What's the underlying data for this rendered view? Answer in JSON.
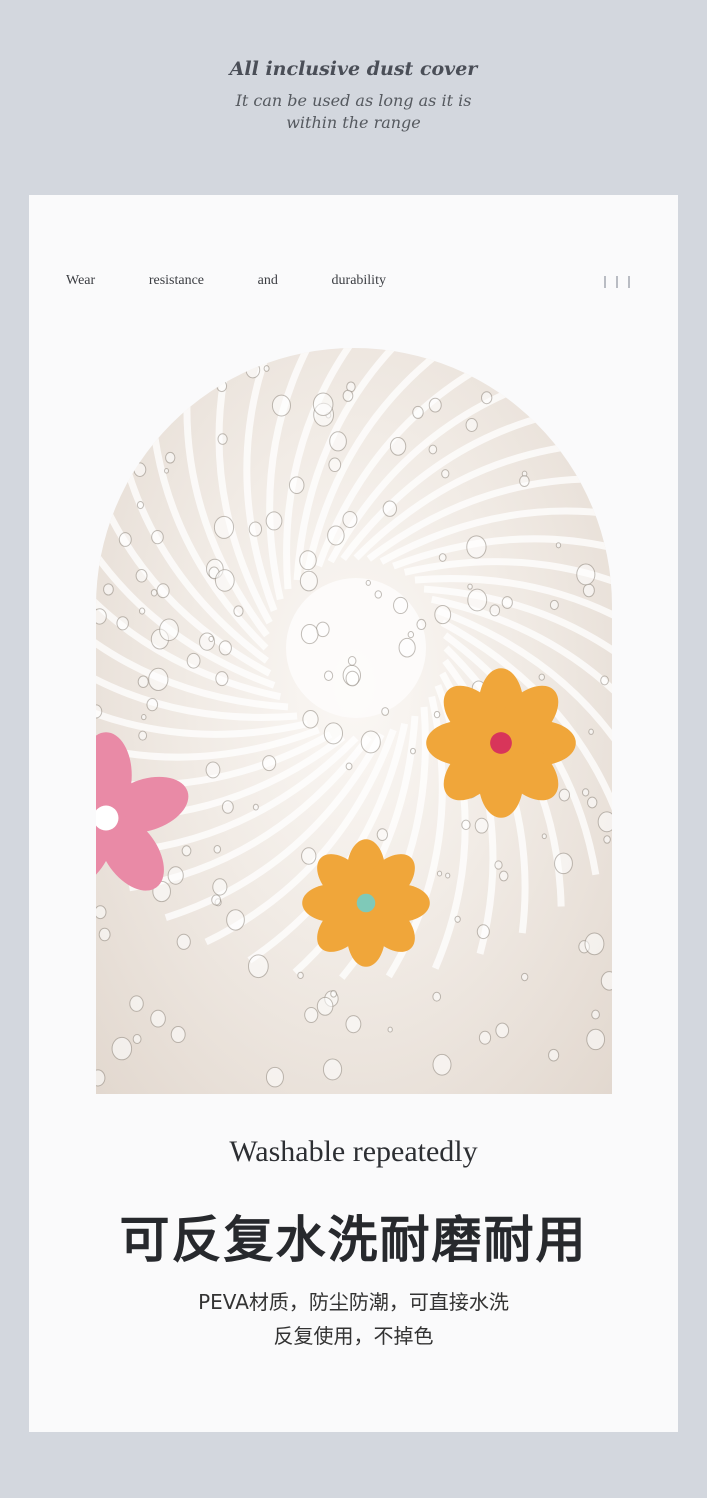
{
  "header": {
    "title": "All inclusive dust cover",
    "subtitle_line1": "It can be used as long as it is",
    "subtitle_line2": "within the range"
  },
  "card": {
    "tagline": [
      "Wear",
      "resistance",
      "and",
      "durability"
    ],
    "product_image": "fan-with-flower-dust-cover-water-droplets",
    "caption_en": "Washable repeatedly",
    "caption_cn": "可反复水洗耐磨耐用",
    "desc_line1": "PEVA材质，防尘防潮，可直接水洗",
    "desc_line2": "反复使用，不掉色"
  },
  "colors": {
    "background": "#d3d7de",
    "card": "#fafafb",
    "flower_orange": "#f0a63a",
    "flower_pink": "#e98aa6"
  }
}
